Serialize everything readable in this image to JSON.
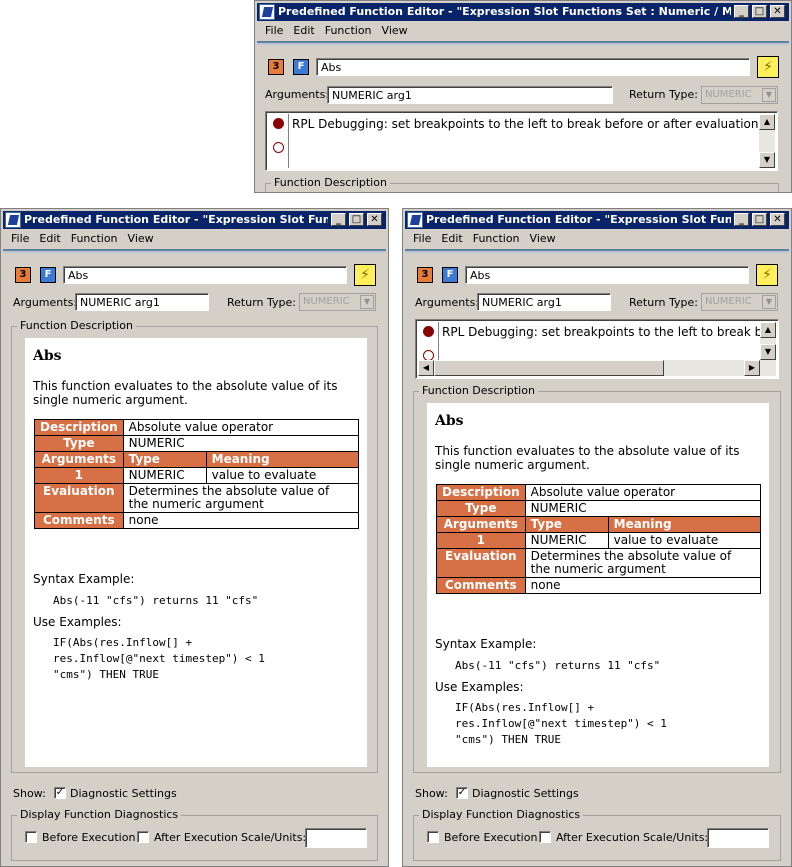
{
  "window_top": {
    "title": "Predefined Function Editor - \"Expression Slot Functions Set : Numeric / Math : A...",
    "menu": [
      "File",
      "Edit",
      "Function",
      "View"
    ],
    "name_value": "Abs",
    "arguments_label": "Arguments:",
    "arguments_value": "NUMERIC arg1",
    "return_type_label": "Return Type:",
    "return_type_value": "NUMERIC",
    "rpl_message": "RPL Debugging: set breakpoints to the left to break before or after evaluation.",
    "function_description_label": "Function Description"
  },
  "window_left": {
    "title": "Predefined Function Editor - \"Expression Slot Functio...",
    "menu": [
      "File",
      "Edit",
      "Function",
      "View"
    ],
    "name_value": "Abs",
    "arguments_label": "Arguments:",
    "arguments_value": "NUMERIC arg1",
    "return_type_label": "Return Type:",
    "return_type_value": "NUMERIC",
    "function_description_label": "Function Description",
    "show_label": "Show:",
    "diagnostic_settings_label": "Diagnostic Settings",
    "display_diagnostics_label": "Display Function Diagnostics",
    "before_execution_label": "Before Execution",
    "after_execution_label": "After Execution",
    "scale_units_label": "Scale/Units:"
  },
  "window_right": {
    "title": "Predefined Function Editor - \"Expression Slot Functio...",
    "menu": [
      "File",
      "Edit",
      "Function",
      "View"
    ],
    "name_value": "Abs",
    "arguments_label": "Arguments:",
    "arguments_value": "NUMERIC arg1",
    "return_type_label": "Return Type:",
    "return_type_value": "NUMERIC",
    "rpl_message": "RPL Debugging: set breakpoints to the left to break befo",
    "function_description_label": "Function Description",
    "show_label": "Show:",
    "diagnostic_settings_label": "Diagnostic Settings",
    "display_diagnostics_label": "Display Function Diagnostics",
    "before_execution_label": "Before Execution",
    "after_execution_label": "After Execution",
    "scale_units_label": "Scale/Units:"
  },
  "doc": {
    "title": "Abs",
    "intro_line1": "This function evaluates to the absolute value of its",
    "intro_line2": "single numeric argument.",
    "table": {
      "description_label": "Description",
      "description_value": "Absolute value operator",
      "type_label": "Type",
      "type_value": "NUMERIC",
      "arguments_label": "Arguments",
      "col_type": "Type",
      "col_meaning": "Meaning",
      "arg_num": "1",
      "arg_type": "NUMERIC",
      "arg_meaning": "value to evaluate",
      "evaluation_label": "Evaluation",
      "evaluation_line1": "Determines the absolute value of",
      "evaluation_line2": "the numeric argument",
      "comments_label": "Comments",
      "comments_value": "none"
    },
    "syntax_label": "Syntax Example:",
    "syntax_code": "Abs(-11 \"cfs\") returns 11 \"cfs\"",
    "use_label": "Use Examples:",
    "use_line1": "IF(Abs(res.Inflow[] +",
    "use_line2": "res.Inflow[@\"next timestep\") < 1",
    "use_line3": "\"cms\") THEN TRUE"
  },
  "icons": {
    "rpl": "rpl-debug-icon",
    "function": "function-f-icon",
    "evaluate": "lightning-icon"
  },
  "colors": {
    "titlebar": "#0a246a",
    "table_header": "#d87045",
    "breakpoint": "#8b0000"
  }
}
